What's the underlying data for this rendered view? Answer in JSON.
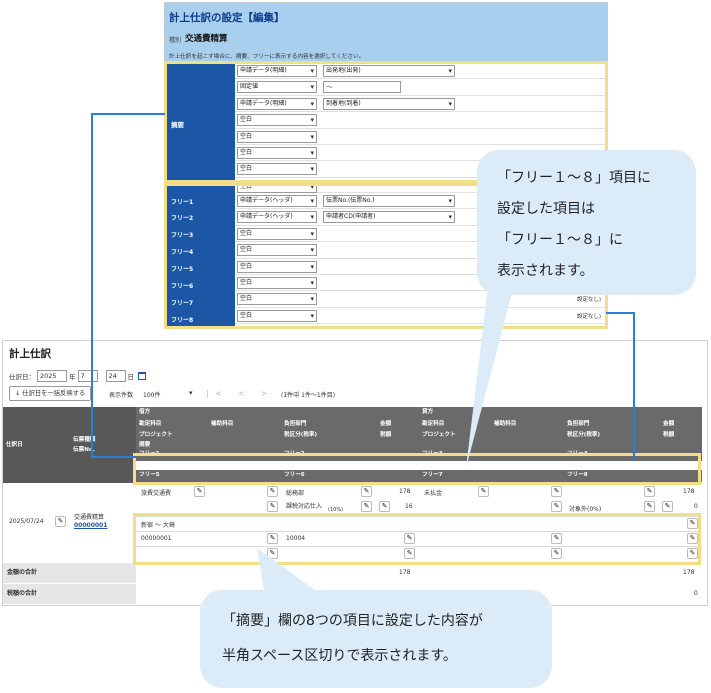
{
  "dialog": {
    "title": "計上仕訳の設定【編集】",
    "type_label": "種別",
    "type_value": "交通費精算",
    "description": "計上仕訳を起こす場合に、摘要、フリーに表示する内容を選択してください。",
    "summary_label": "摘要",
    "summary_rows": [
      {
        "src": "申請データ(明細)",
        "item": "出発地(出発)"
      },
      {
        "src": "固定値",
        "text": "〜"
      },
      {
        "src": "申請データ(明細)",
        "item": "到着地(到着)"
      },
      {
        "src": "空白"
      },
      {
        "src": "空白"
      },
      {
        "src": "空白"
      },
      {
        "src": "空白"
      },
      {
        "src": "空白"
      }
    ],
    "free_rows": [
      {
        "label": "フリー1",
        "src": "申請データ(ヘッダ)",
        "item": "伝票No.(伝票No.)"
      },
      {
        "label": "フリー2",
        "src": "申請データ(ヘッダ)",
        "item": "申請者CD(申請者)"
      },
      {
        "label": "フリー3",
        "src": "空白"
      },
      {
        "label": "フリー4",
        "src": "空白"
      },
      {
        "label": "フリー5",
        "src": "空白"
      },
      {
        "label": "フリー6",
        "src": "空白"
      },
      {
        "label": "フリー7",
        "src": "空白",
        "note": "設定なし)"
      },
      {
        "label": "フリー8",
        "src": "空白",
        "note": "設定なし)"
      }
    ]
  },
  "screen": {
    "title": "計上仕訳",
    "date_label": "仕訳日：",
    "year": "2025",
    "year_unit": "年",
    "month": "7",
    "day": "24",
    "day_unit": "日",
    "download_label": "↓ 仕訳日を一括反映する",
    "perpage_label": "表示件数",
    "perpage_value": "100件",
    "pager_icons": "|< < > >|",
    "page_info": "(1件中 1件〜1件目)",
    "grid": {
      "col_date": "仕訳日",
      "col_slip": "伝票種類",
      "col_slip2": "伝票No.",
      "debit": "借方",
      "credit": "貸方",
      "account": "勘定科目",
      "subaccount": "補助科目",
      "dept": "負担部門",
      "amount": "金額",
      "project": "プロジェクト",
      "tax": "税区分(税率)",
      "tax_amount": "税額",
      "summary": "摘要",
      "free": [
        "フリー1",
        "フリー2",
        "フリー3",
        "フリー4",
        "フリー5",
        "フリー6",
        "フリー7",
        "フリー8"
      ]
    },
    "row": {
      "date": "2025/07/24",
      "slip_type": "交通費精算",
      "slip_no": "00000001",
      "debit_account": "旅費交通費",
      "debit_dept": "総務部",
      "debit_amount": "178",
      "debit_tax": "課税対応仕入",
      "debit_tax_rate": "(10%)",
      "debit_tax_amount": "16",
      "credit_account": "未払金",
      "credit_amount": "178",
      "credit_tax": "対象外(0%)",
      "credit_tax_amount": "0",
      "summary_text": "新宿 〜 大崎",
      "free1": "00000001",
      "free2": "10004"
    },
    "totals": {
      "amount_label": "金額の合計",
      "amount_debit": "178",
      "amount_credit": "178",
      "tax_label": "税額の合計",
      "tax_credit": "0"
    }
  },
  "callouts": {
    "free": [
      "「フリー１〜８」項目に",
      "設定した項目は",
      "「フリー１〜８」に",
      "表示されます。"
    ],
    "summary": [
      "「摘要」欄の8つの項目に設定した内容が",
      "半角スペース区切りで表示されます。"
    ]
  },
  "colors": {
    "header": "#a9cfee",
    "label_blue": "#1c57a6",
    "highlight": "#f2de86",
    "callout": "#dbebf8",
    "connector": "#2a7fd4",
    "grid_header": "#6a6a6a"
  }
}
